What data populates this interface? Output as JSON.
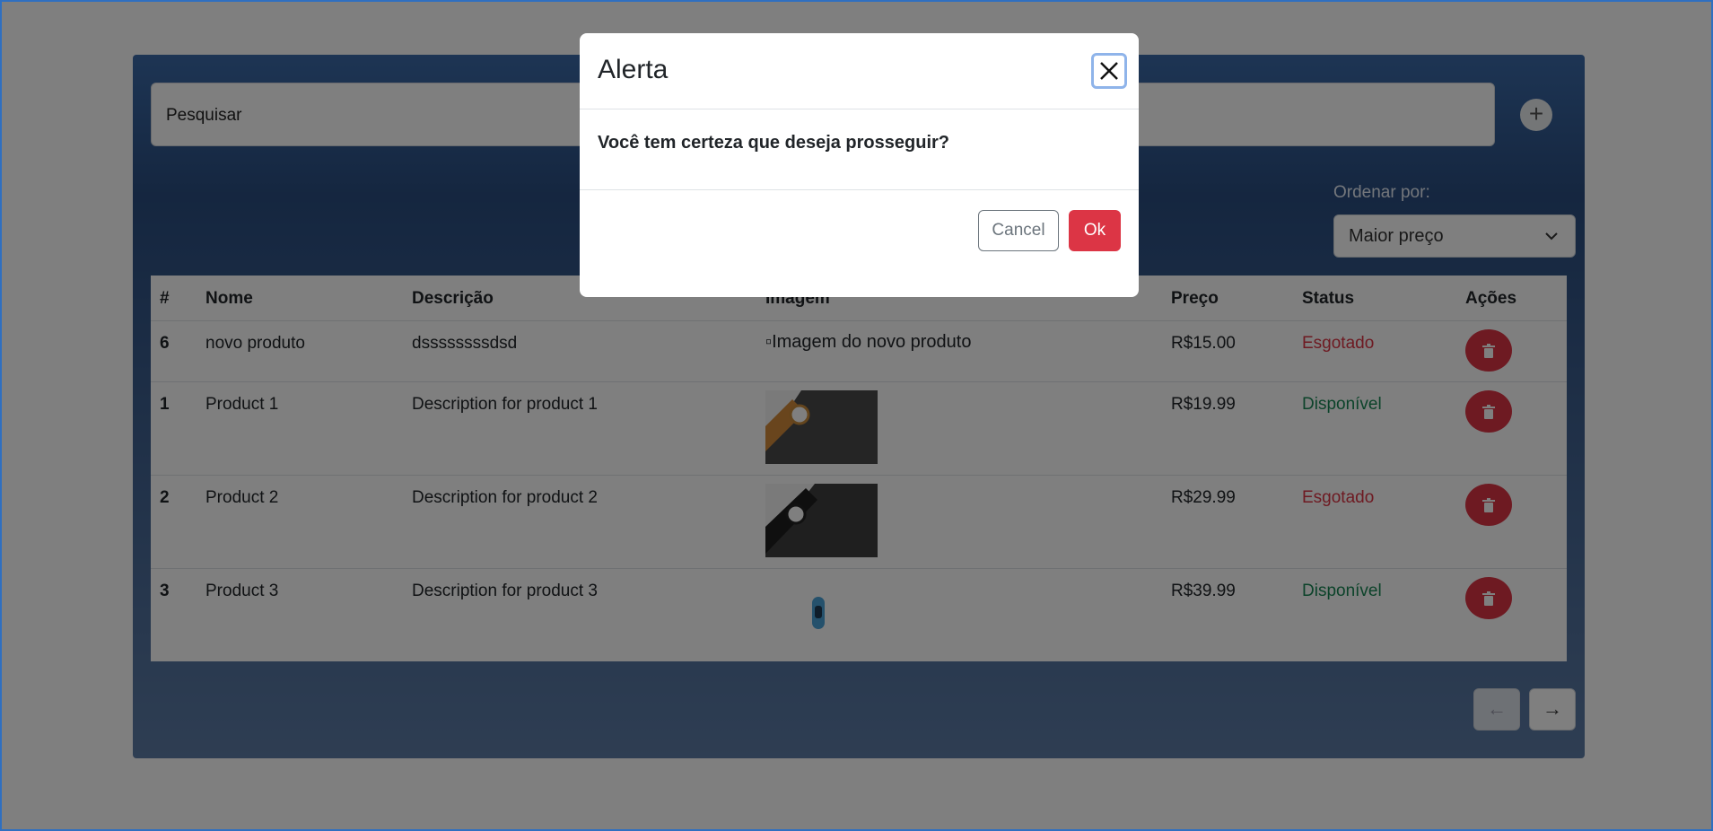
{
  "search": {
    "placeholder": "Pesquisar"
  },
  "sort": {
    "label": "Ordenar por:",
    "selected": "Maior preço"
  },
  "table": {
    "headers": [
      "#",
      "Nome",
      "Descrição",
      "Imagem",
      "Preço",
      "Status",
      "Ações"
    ],
    "rows": [
      {
        "id": "6",
        "name": "novo produto",
        "description": "dssssssssdsd",
        "image_alt": "Imagem do novo produto",
        "price": "R$15.00",
        "status": "Esgotado"
      },
      {
        "id": "1",
        "name": "Product 1",
        "description": "Description for product 1",
        "price": "R$19.99",
        "status": "Disponível"
      },
      {
        "id": "2",
        "name": "Product 2",
        "description": "Description for product 2",
        "price": "R$29.99",
        "status": "Esgotado"
      },
      {
        "id": "3",
        "name": "Product 3",
        "description": "Description for product 3",
        "price": "R$39.99",
        "status": "Disponível"
      }
    ]
  },
  "pager": {
    "prev": "←",
    "next": "→"
  },
  "modal": {
    "title": "Alerta",
    "message": "Você tem certeza que deseja prosseguir?",
    "cancel": "Cancel",
    "ok": "Ok"
  },
  "colors": {
    "danger": "#dc3545",
    "success": "#198754",
    "card": "#2a4d80"
  },
  "icons": [
    "plus-icon",
    "chevron-down-icon",
    "trash-icon",
    "arrow-left-icon",
    "arrow-right-icon",
    "close-icon"
  ]
}
